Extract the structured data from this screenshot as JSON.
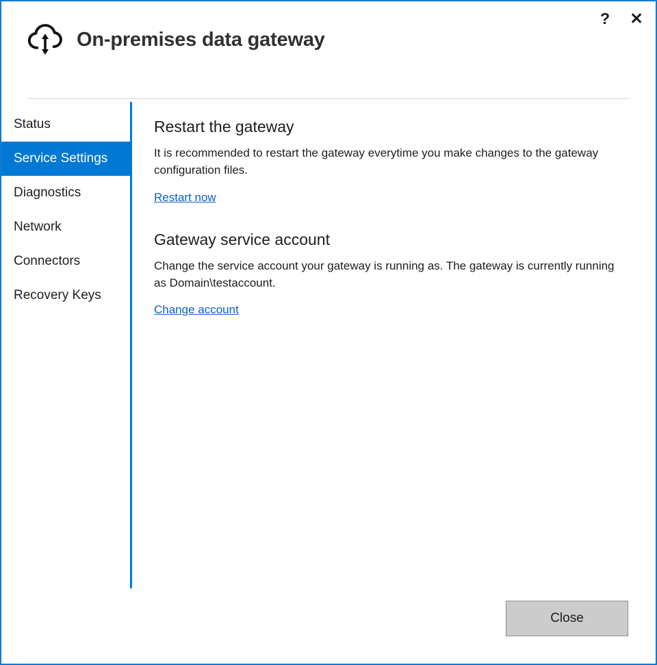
{
  "window": {
    "title": "On-premises data gateway",
    "icon": "cloud-updown-arrow-icon",
    "accent_color": "#0078d4",
    "border_color": "#0f7bd6",
    "help_label": "?",
    "close_label": "✕"
  },
  "sidebar": {
    "items": [
      {
        "label": "Status",
        "selected": false
      },
      {
        "label": "Service Settings",
        "selected": true
      },
      {
        "label": "Diagnostics",
        "selected": false
      },
      {
        "label": "Network",
        "selected": false
      },
      {
        "label": "Connectors",
        "selected": false
      },
      {
        "label": "Recovery Keys",
        "selected": false
      }
    ]
  },
  "main": {
    "sections": [
      {
        "heading": "Restart the gateway",
        "body": "It is recommended to restart the gateway everytime you make changes to the gateway configuration files.",
        "link": "Restart now"
      },
      {
        "heading": "Gateway service account",
        "body": "Change the service account your gateway is running as. The gateway is currently running as Domain\\testaccount.",
        "link": "Change account"
      }
    ]
  },
  "footer": {
    "close_label": "Close"
  }
}
